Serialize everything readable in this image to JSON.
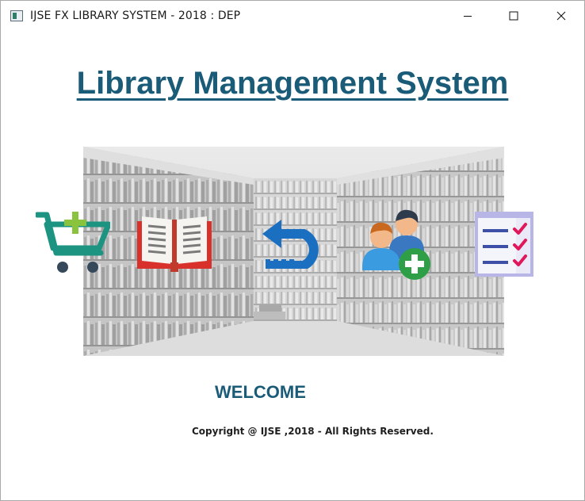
{
  "window": {
    "title": "IJSE FX LIBRARY SYSTEM - 2018 : DEP",
    "controls": [
      "minimize-icon",
      "maximize-icon",
      "close-icon"
    ]
  },
  "main": {
    "title": "Library Management System",
    "nav_icons": [
      "add-to-cart-icon",
      "book-icon",
      "return-icon",
      "add-member-icon",
      "checklist-report-icon"
    ],
    "welcome": "WELCOME",
    "copyright": "Copyright @ IJSE ,2018 - All Rights Reserved."
  },
  "colors": {
    "heading": "#1a5b78",
    "cart": "#1d9381",
    "cart_plus": "#8ac43f",
    "book": "#d8312b",
    "return": "#1a6fc1",
    "member_plus": "#2e9e47",
    "report_frame": "#b7b6e6",
    "report_check": "#e0175b"
  }
}
